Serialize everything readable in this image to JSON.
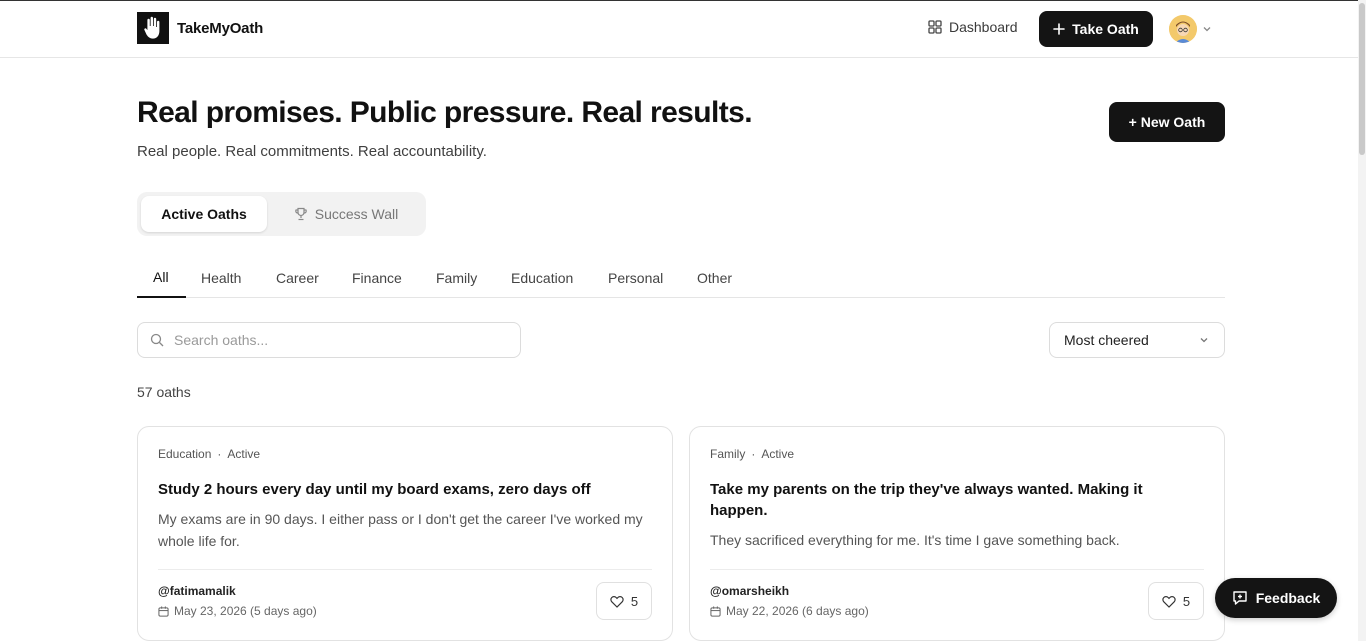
{
  "nav": {
    "brand": "TakeMyOath",
    "dashboard_label": "Dashboard",
    "take_oath_label": "Take Oath"
  },
  "hero": {
    "title": "Real promises. Public pressure. Real results.",
    "subtitle": "Real people. Real commitments. Real accountability.",
    "new_oath_label": "+ New Oath"
  },
  "view_tabs": [
    {
      "label": "Active Oaths",
      "active": true
    },
    {
      "label": "Success Wall",
      "active": false
    }
  ],
  "categories": [
    {
      "label": "All",
      "active": true
    },
    {
      "label": "Health"
    },
    {
      "label": "Career"
    },
    {
      "label": "Finance"
    },
    {
      "label": "Family"
    },
    {
      "label": "Education"
    },
    {
      "label": "Personal"
    },
    {
      "label": "Other"
    }
  ],
  "search": {
    "placeholder": "Search oaths...",
    "value": ""
  },
  "sort": {
    "selected": "Most cheered"
  },
  "count_label": "57 oaths",
  "oaths": [
    {
      "category": "Education",
      "status": "Active",
      "title": "Study 2 hours every day until my board exams, zero days off",
      "description": "My exams are in 90 days. I either pass or I don't get the career I've worked my whole life for.",
      "user": "@fatimamalik",
      "date": "May 23, 2026 (5 days ago)",
      "cheers": "5"
    },
    {
      "category": "Family",
      "status": "Active",
      "title": "Take my parents on the trip they've always wanted. Making it happen.",
      "description": "They sacrificed everything for me. It's time I gave something back.",
      "user": "@omarsheikh",
      "date": "May 22, 2026 (6 days ago)",
      "cheers": "5"
    }
  ],
  "feedback_label": "Feedback",
  "meta_separator": "·"
}
